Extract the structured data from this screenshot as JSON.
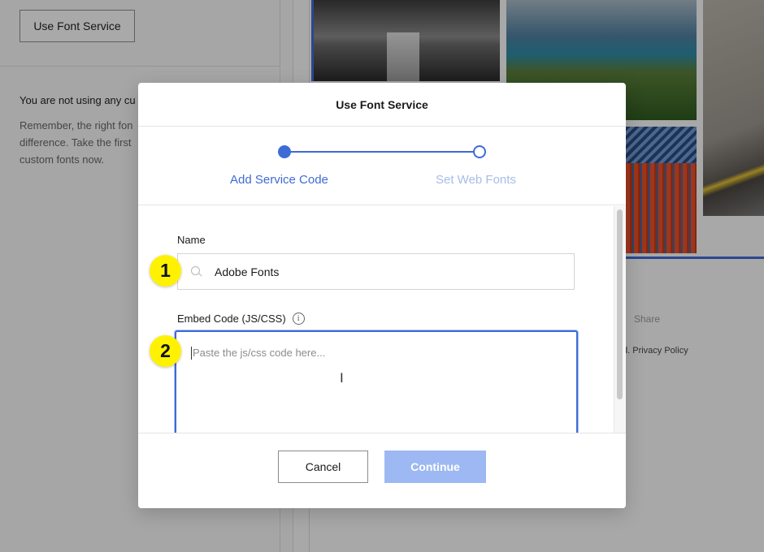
{
  "background": {
    "font_service_button": "Use Font Service",
    "notice_line": "You are not using any cu",
    "notice_body": "Remember, the right fon difference. Take the first custom fonts now.",
    "share_label": "Share",
    "footer_text": "d. Privacy Policy"
  },
  "modal": {
    "title": "Use Font Service",
    "steps": [
      {
        "label": "Add Service Code",
        "state": "active"
      },
      {
        "label": "Set Web Fonts",
        "state": "upcoming"
      }
    ],
    "name_field": {
      "label": "Name",
      "value": "Adobe Fonts",
      "icon": "search-icon"
    },
    "embed_field": {
      "label": "Embed Code (JS/CSS)",
      "info_icon_glyph": "i",
      "placeholder": "Paste the js/css code here..."
    },
    "annotations": [
      "1",
      "2"
    ],
    "buttons": {
      "cancel": "Cancel",
      "continue": "Continue"
    }
  },
  "colors": {
    "accent": "#3f6bd6",
    "step_inactive_label": "#a6bde8",
    "continue_disabled": "#9db8f2",
    "annotation_badge": "#fff200"
  }
}
